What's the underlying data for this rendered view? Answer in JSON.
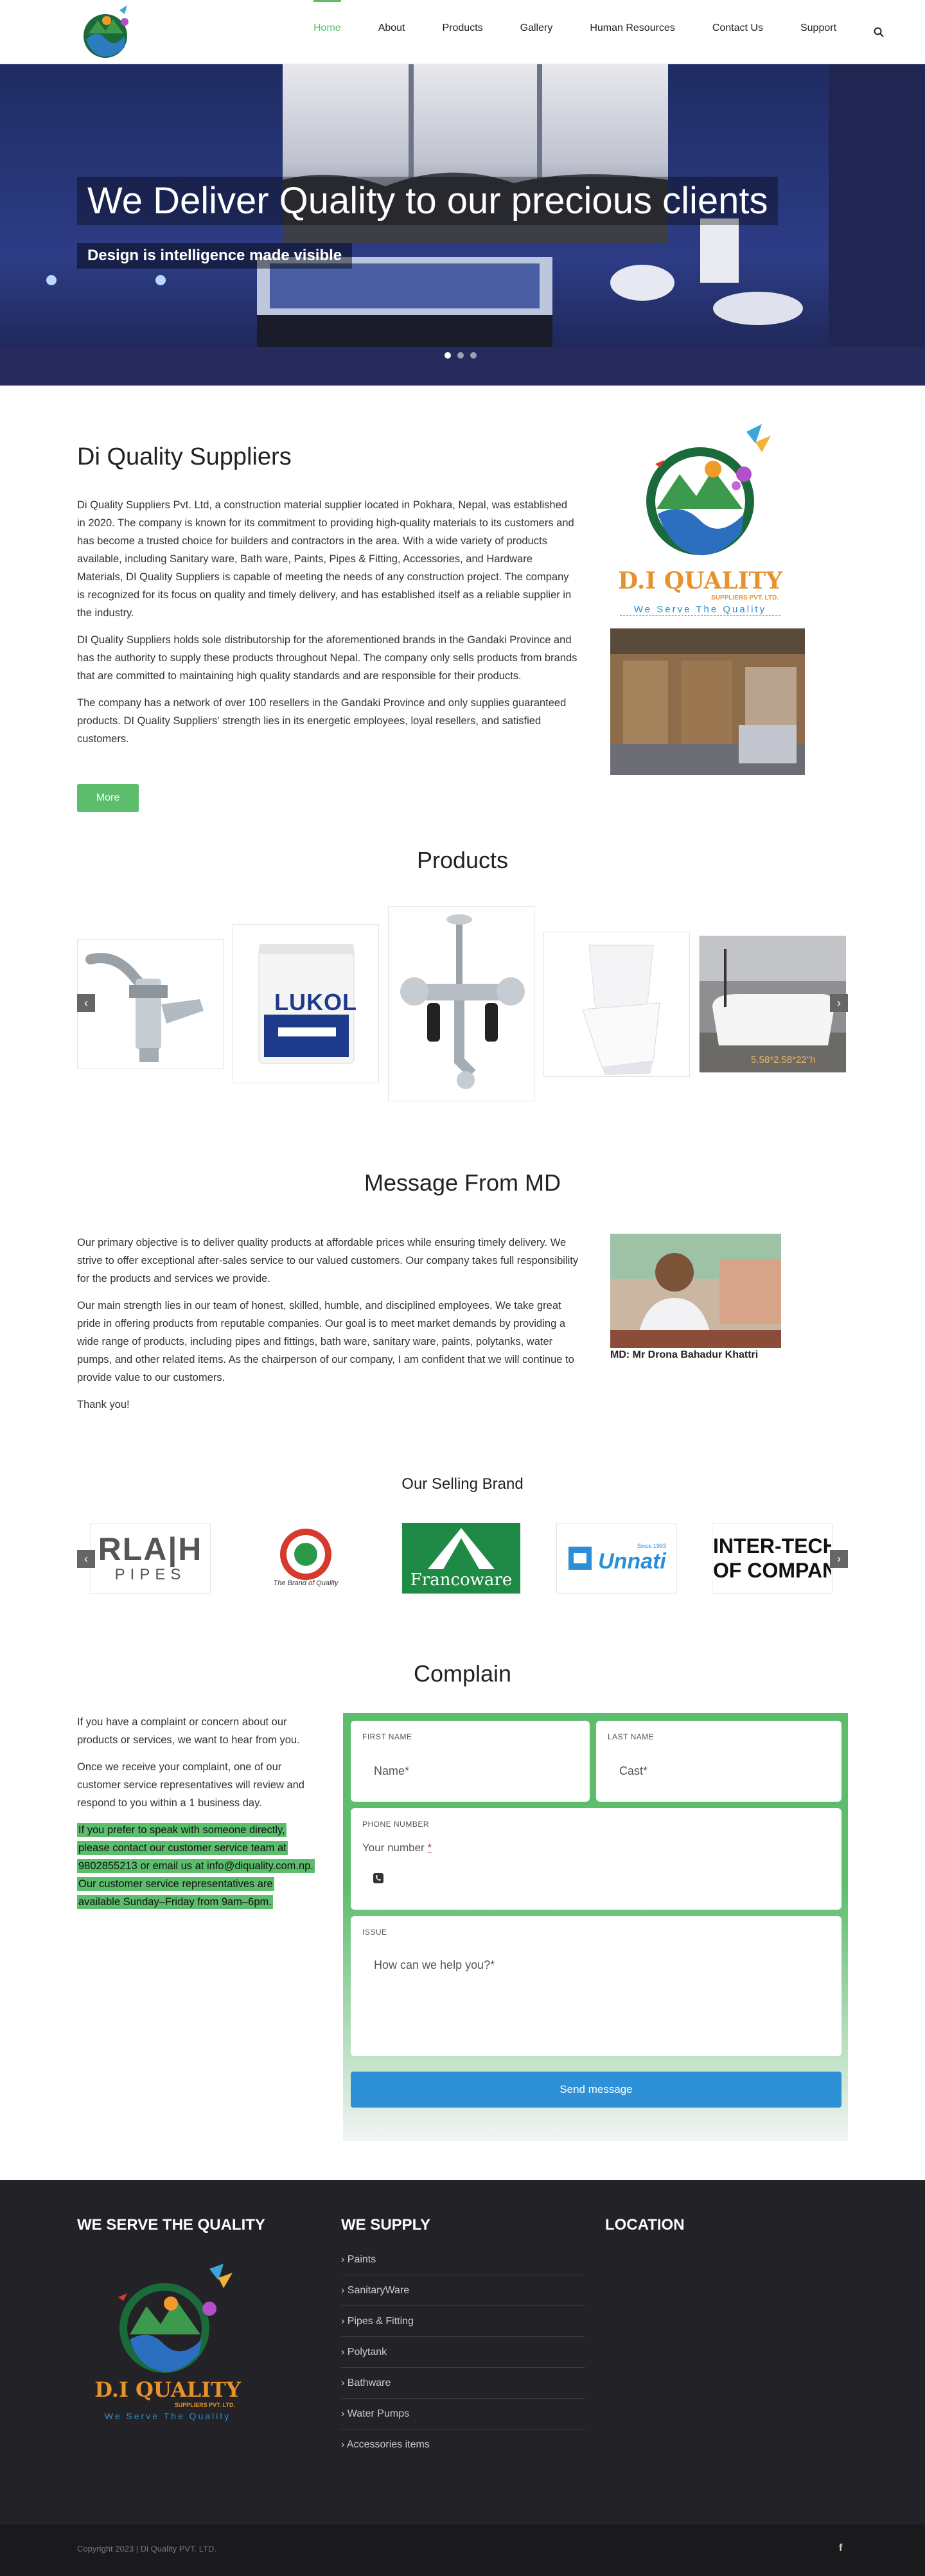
{
  "nav": {
    "items": [
      {
        "label": "Home",
        "active": true
      },
      {
        "label": "About"
      },
      {
        "label": "Products"
      },
      {
        "label": "Gallery"
      },
      {
        "label": "Human Resources"
      },
      {
        "label": "Contact Us"
      },
      {
        "label": "Support"
      }
    ],
    "search_icon": "search-icon"
  },
  "hero": {
    "title": "We Deliver Quality to our precious clients",
    "subtitle": "Design is intelligence made visible",
    "slides": 3,
    "active_slide": 1
  },
  "about": {
    "title": "Di Quality Suppliers",
    "paragraphs": [
      "Di Quality Suppliers Pvt. Ltd, a construction material supplier located in Pokhara, Nepal, was established in 2020. The company is known for its commitment to providing high-quality materials to its customers and has become a trusted choice for builders and contractors in the area. With a wide variety of products available, including Sanitary ware, Bath ware, Paints, Pipes & Fitting, Accessories, and Hardware Materials, DI Quality Suppliers is capable of meeting the needs of any construction project. The company is recognized for its focus on quality and timely delivery, and has established itself as a reliable supplier in the industry.",
      "DI Quality Suppliers holds sole distributorship for the aforementioned brands in the Gandaki Province and has the authority to supply these products throughout Nepal. The company only sells products from brands that are committed to maintaining high quality standards and are responsible for their products.",
      "The company has a network of over 100 resellers in the Gandaki Province and only supplies guaranteed products. DI Quality Suppliers' strength lies in its energetic employees, loyal resellers, and satisfied customers."
    ],
    "more_button": "More",
    "logo_name": "D.I QUALITY",
    "logo_sub": "SUPPLIERS PVT. LTD.",
    "logo_tagline": "We Serve The Quality"
  },
  "products": {
    "title": "Products",
    "items": [
      "tap-faucet",
      "lukol-paint-bucket",
      "wall-mixer",
      "toilet",
      "bathtub"
    ],
    "bathtub_caption": "5.58*2.58*22\"h",
    "paint_brand": "LUKOL",
    "prev_icon": "chevron-left-icon",
    "next_icon": "chevron-right-icon"
  },
  "message": {
    "title": "Message From MD",
    "paragraphs": [
      "Our primary objective is to deliver quality products at affordable prices while ensuring timely delivery. We strive to offer exceptional after-sales service to our valued customers. Our company takes full responsibility for the products and services we provide.",
      "Our main strength lies in our team of honest, skilled, humble, and disciplined employees. We take great pride in offering products from reputable companies. Our goal is to meet market demands by providing a wide range of products, including pipes and fittings, bath ware, sanitary ware, paints, polytanks, water pumps, and other related items. As the chairperson of our company, I am confident that we will continue to provide value to our customers.",
      "Thank you!"
    ],
    "caption": "MD: Mr Drona Bahadur Khattri"
  },
  "brands": {
    "title": "Our Selling Brand",
    "items": [
      {
        "line1": "RLA|H",
        "line2": "PIPES"
      },
      {
        "line1": "",
        "line2": "The Brand of Quality"
      },
      {
        "line1": "Francoware",
        "line2": ""
      },
      {
        "line1": "Unnati",
        "line2": "Since 1993"
      },
      {
        "line1": "INTER-TECH",
        "line2": "OF COMPAN"
      }
    ]
  },
  "complain": {
    "title": "Complain",
    "paragraphs": [
      "If you have a complaint or concern about our products or services, we want to hear from you.",
      "Once we receive your complaint, one of our customer service representatives will review and respond to you within a 1 business day."
    ],
    "highlight": "If you prefer to speak with someone directly, please contact our customer service team at 9802855213 or email us at info@diquality.com.np. Our customer service representatives are available Sunday–Friday from 9am–6pm.",
    "form": {
      "first_label": "FIRST NAME",
      "first_placeholder": "Name*",
      "last_label": "LAST NAME",
      "last_placeholder": "Cast*",
      "phone_label": "PHONE NUMBER",
      "phone_placeholder": "Your number",
      "phone_required": "*",
      "issue_label": "ISSUE",
      "issue_placeholder": "How can we help you?*",
      "send": "Send message"
    }
  },
  "footer": {
    "col1": "WE SERVE THE QUALITY",
    "col2": "WE SUPPLY",
    "col3": "LOCATION",
    "supply_items": [
      "Paints",
      "SanitaryWare",
      "Pipes & Fitting",
      "Polytank",
      "Bathware",
      "Water Pumps",
      "Accessories items"
    ],
    "logo_name": "D.I QUALITY",
    "logo_sub": "SUPPLIERS PVT. LTD.",
    "logo_tagline": "We Serve The Quality",
    "copyright": "Copyright 2023 | Di Quality PVT. LTD.",
    "facebook_icon": "facebook-icon"
  },
  "colors": {
    "accent": "#5cbd6c",
    "button_blue": "#2e90d6",
    "footer_bg": "#232227",
    "logo_orange": "#e7922c"
  }
}
